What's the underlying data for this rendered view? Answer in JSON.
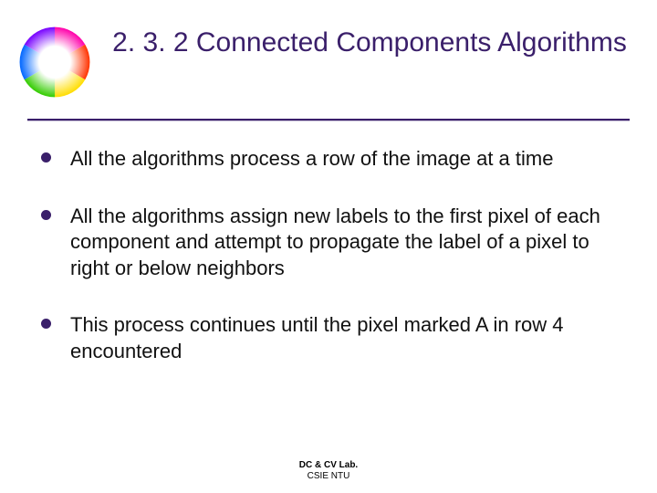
{
  "title": "2. 3. 2 Connected Components Algorithms",
  "bullets": [
    "All the algorithms process a row of the image at a time",
    "All the algorithms assign new labels to the first pixel of each component and attempt to propagate the label of a pixel to right or below neighbors",
    "This process continues until the pixel marked A in row 4 encountered"
  ],
  "footer": {
    "line1": "DC & CV Lab.",
    "line2": "CSIE NTU"
  }
}
